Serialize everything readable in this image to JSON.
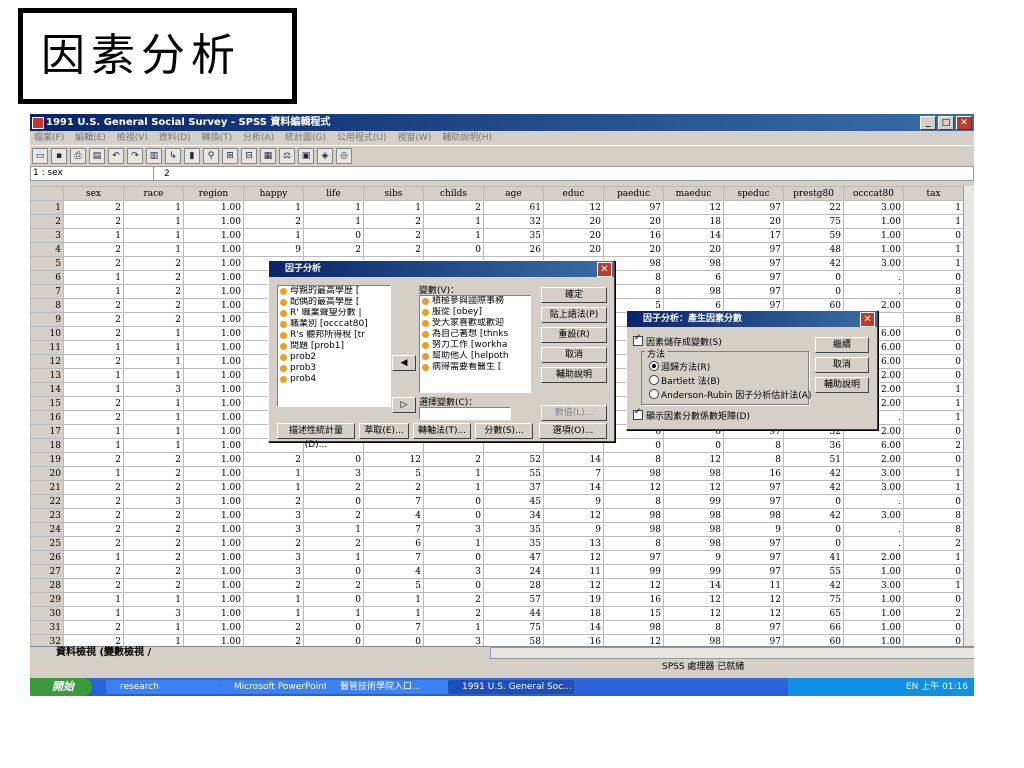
{
  "slide": {
    "title": "因素分析"
  },
  "window": {
    "title": "1991 U.S. General Social Survey - SPSS 資料編輯程式",
    "menu": [
      "檔案(F)",
      "編輯(E)",
      "檢視(V)",
      "資料(D)",
      "轉換(T)",
      "分析(A)",
      "統計圖(G)",
      "公用程式(U)",
      "視窗(W)",
      "輔助說明(H)"
    ],
    "cell_ref": "1 : sex",
    "cell_value": "2"
  },
  "grid": {
    "columns": [
      "sex",
      "race",
      "region",
      "happy",
      "life",
      "sibs",
      "childs",
      "age",
      "educ",
      "paeduc",
      "maeduc",
      "speduc",
      "prestg80",
      "occcat80",
      "tax"
    ],
    "rows": [
      [
        "1",
        "2",
        "1",
        "1.00",
        "1",
        "1",
        "1",
        "2",
        "61",
        "12",
        "97",
        "12",
        "97",
        "22",
        "3.00",
        "1"
      ],
      [
        "2",
        "2",
        "1",
        "1.00",
        "2",
        "1",
        "2",
        "1",
        "32",
        "20",
        "20",
        "18",
        "20",
        "75",
        "1.00",
        "1"
      ],
      [
        "3",
        "1",
        "1",
        "1.00",
        "1",
        "0",
        "2",
        "1",
        "35",
        "20",
        "16",
        "14",
        "17",
        "59",
        "1.00",
        "0"
      ],
      [
        "4",
        "2",
        "1",
        "1.00",
        "9",
        "2",
        "2",
        "0",
        "26",
        "20",
        "20",
        "20",
        "97",
        "48",
        "1.00",
        "1"
      ],
      [
        "5",
        "2",
        "2",
        "1.00",
        "",
        "",
        "",
        "",
        "",
        "",
        "98",
        "98",
        "97",
        "42",
        "3.00",
        "1"
      ],
      [
        "6",
        "1",
        "2",
        "1.00",
        "",
        "",
        "",
        "",
        "",
        "",
        "8",
        "6",
        "97",
        "0",
        ".",
        "0"
      ],
      [
        "7",
        "1",
        "2",
        "1.00",
        "",
        "",
        "",
        "",
        "",
        "",
        "8",
        "98",
        "97",
        "0",
        ".",
        "8"
      ],
      [
        "8",
        "2",
        "2",
        "1.00",
        "",
        "",
        "",
        "",
        "",
        "",
        "5",
        "6",
        "97",
        "60",
        "2.00",
        "0"
      ],
      [
        "9",
        "2",
        "2",
        "1.00",
        "",
        "",
        "",
        "",
        "",
        "",
        "",
        "",
        "",
        "",
        "",
        "8"
      ],
      [
        "10",
        "2",
        "1",
        "1.00",
        "",
        "",
        "",
        "",
        "",
        "",
        "",
        "",
        "",
        "",
        "6.00",
        "0"
      ],
      [
        "11",
        "1",
        "1",
        "1.00",
        "",
        "",
        "",
        "",
        "",
        "",
        "",
        "",
        "",
        "",
        "6.00",
        "0"
      ],
      [
        "12",
        "2",
        "1",
        "1.00",
        "",
        "",
        "",
        "",
        "",
        "",
        "",
        "",
        "",
        "",
        "6.00",
        "0"
      ],
      [
        "13",
        "1",
        "1",
        "1.00",
        "",
        "",
        "",
        "",
        "",
        "",
        "",
        "",
        "",
        "",
        "2.00",
        "0"
      ],
      [
        "14",
        "1",
        "3",
        "1.00",
        "",
        "",
        "",
        "",
        "",
        "",
        "",
        "",
        "",
        "",
        "2.00",
        "1"
      ],
      [
        "15",
        "2",
        "1",
        "1.00",
        "",
        "",
        "",
        "",
        "",
        "",
        "",
        "",
        "",
        "",
        "2.00",
        "1"
      ],
      [
        "16",
        "2",
        "1",
        "1.00",
        "",
        "",
        "",
        "",
        "",
        "",
        "",
        "",
        "",
        "",
        ".",
        "1"
      ],
      [
        "17",
        "1",
        "1",
        "1.00",
        "",
        "",
        "",
        "",
        "",
        "",
        "6",
        "6",
        "97",
        "32",
        "2.00",
        "0"
      ],
      [
        "18",
        "1",
        "1",
        "1.00",
        "",
        "",
        "",
        "",
        "",
        "",
        "0",
        "0",
        "8",
        "36",
        "6.00",
        "2"
      ],
      [
        "19",
        "2",
        "2",
        "1.00",
        "2",
        "0",
        "12",
        "2",
        "52",
        "14",
        "8",
        "12",
        "8",
        "51",
        "2.00",
        "0"
      ],
      [
        "20",
        "1",
        "2",
        "1.00",
        "1",
        "3",
        "5",
        "1",
        "55",
        "7",
        "98",
        "98",
        "16",
        "42",
        "3.00",
        "1"
      ],
      [
        "21",
        "2",
        "2",
        "1.00",
        "1",
        "2",
        "2",
        "1",
        "37",
        "14",
        "12",
        "12",
        "97",
        "42",
        "3.00",
        "1"
      ],
      [
        "22",
        "2",
        "3",
        "1.00",
        "2",
        "0",
        "7",
        "0",
        "45",
        "9",
        "8",
        "99",
        "97",
        "0",
        ".",
        "0"
      ],
      [
        "23",
        "2",
        "2",
        "1.00",
        "3",
        "2",
        "4",
        "0",
        "34",
        "12",
        "98",
        "98",
        "98",
        "42",
        "3.00",
        "8"
      ],
      [
        "24",
        "2",
        "2",
        "1.00",
        "3",
        "1",
        "7",
        "3",
        "35",
        "9",
        "98",
        "98",
        "9",
        "0",
        ".",
        "8"
      ],
      [
        "25",
        "2",
        "2",
        "1.00",
        "2",
        "2",
        "6",
        "1",
        "35",
        "13",
        "8",
        "98",
        "97",
        "0",
        ".",
        "2"
      ],
      [
        "26",
        "1",
        "2",
        "1.00",
        "3",
        "1",
        "7",
        "0",
        "47",
        "12",
        "97",
        "9",
        "97",
        "41",
        "2.00",
        "1"
      ],
      [
        "27",
        "2",
        "2",
        "1.00",
        "3",
        "0",
        "4",
        "3",
        "24",
        "11",
        "99",
        "99",
        "97",
        "55",
        "1.00",
        "0"
      ],
      [
        "28",
        "2",
        "2",
        "1.00",
        "2",
        "2",
        "5",
        "0",
        "28",
        "12",
        "12",
        "14",
        "11",
        "42",
        "3.00",
        "1"
      ],
      [
        "29",
        "1",
        "1",
        "1.00",
        "1",
        "0",
        "1",
        "2",
        "57",
        "19",
        "16",
        "12",
        "12",
        "75",
        "1.00",
        "0"
      ],
      [
        "30",
        "1",
        "3",
        "1.00",
        "1",
        "1",
        "1",
        "2",
        "44",
        "18",
        "15",
        "12",
        "12",
        "65",
        "1.00",
        "2"
      ],
      [
        "31",
        "2",
        "1",
        "1.00",
        "2",
        "0",
        "7",
        "1",
        "75",
        "14",
        "98",
        "8",
        "97",
        "66",
        "1.00",
        "0"
      ],
      [
        "32",
        "2",
        "1",
        "1.00",
        "2",
        "0",
        "0",
        "3",
        "58",
        "16",
        "12",
        "98",
        "97",
        "60",
        "1.00",
        "0"
      ]
    ]
  },
  "tabs": "資料檢視 (變數檢視 /",
  "status": "SPSS 處理器 已就緒",
  "factor_dialog": {
    "title": "因子分析",
    "source_vars": [
      "母親的最高學歷 [",
      "配偶的最高學歷 [",
      "R' 職業聲望分數 |",
      "職業別 [occcat80]",
      "R's 聽邦所得稅 [tr",
      "問題 [prob1]",
      "prob2",
      "prob3",
      "prob4"
    ],
    "variables_label": "變數(V)：",
    "selected_vars": [
      "積極參與國際事務",
      "服從 [obey]",
      "受大家喜歡或歡迎",
      "為自己著想 [thnks",
      "努力工作 [workha",
      "幫助他人 [helpoth",
      "病得需要看醫生 ["
    ],
    "selection_label": "選擇變數(C)：",
    "value_button": "數值(L)...",
    "right_buttons": [
      "確定",
      "貼上語法(P)",
      "重設(R)",
      "取消",
      "輔助說明"
    ],
    "bottom_buttons": [
      "描述性統計量(D)...",
      "萃取(E)...",
      "轉軸法(T)...",
      "分數(S)...",
      "選項(O)..."
    ]
  },
  "scores_dialog": {
    "title": "因子分析：產生因素分數",
    "save_label": "因素儲存成變數(S)",
    "method_label": "方法",
    "methods": [
      "迴歸方法(R)",
      "Bartlett 法(B)",
      "Anderson-Rubin 因子分析估計法(A)"
    ],
    "display_label": "顯示因素分數係數矩陣(D)",
    "buttons": [
      "繼續",
      "取消",
      "輔助說明"
    ]
  },
  "taskbar": {
    "start": "開始",
    "tasks": [
      "research",
      "Microsoft PowerPoint ...",
      "醫管技術學院入口...",
      "1991 U.S. General Soc..."
    ],
    "tray": "EN  上午 01:16"
  }
}
